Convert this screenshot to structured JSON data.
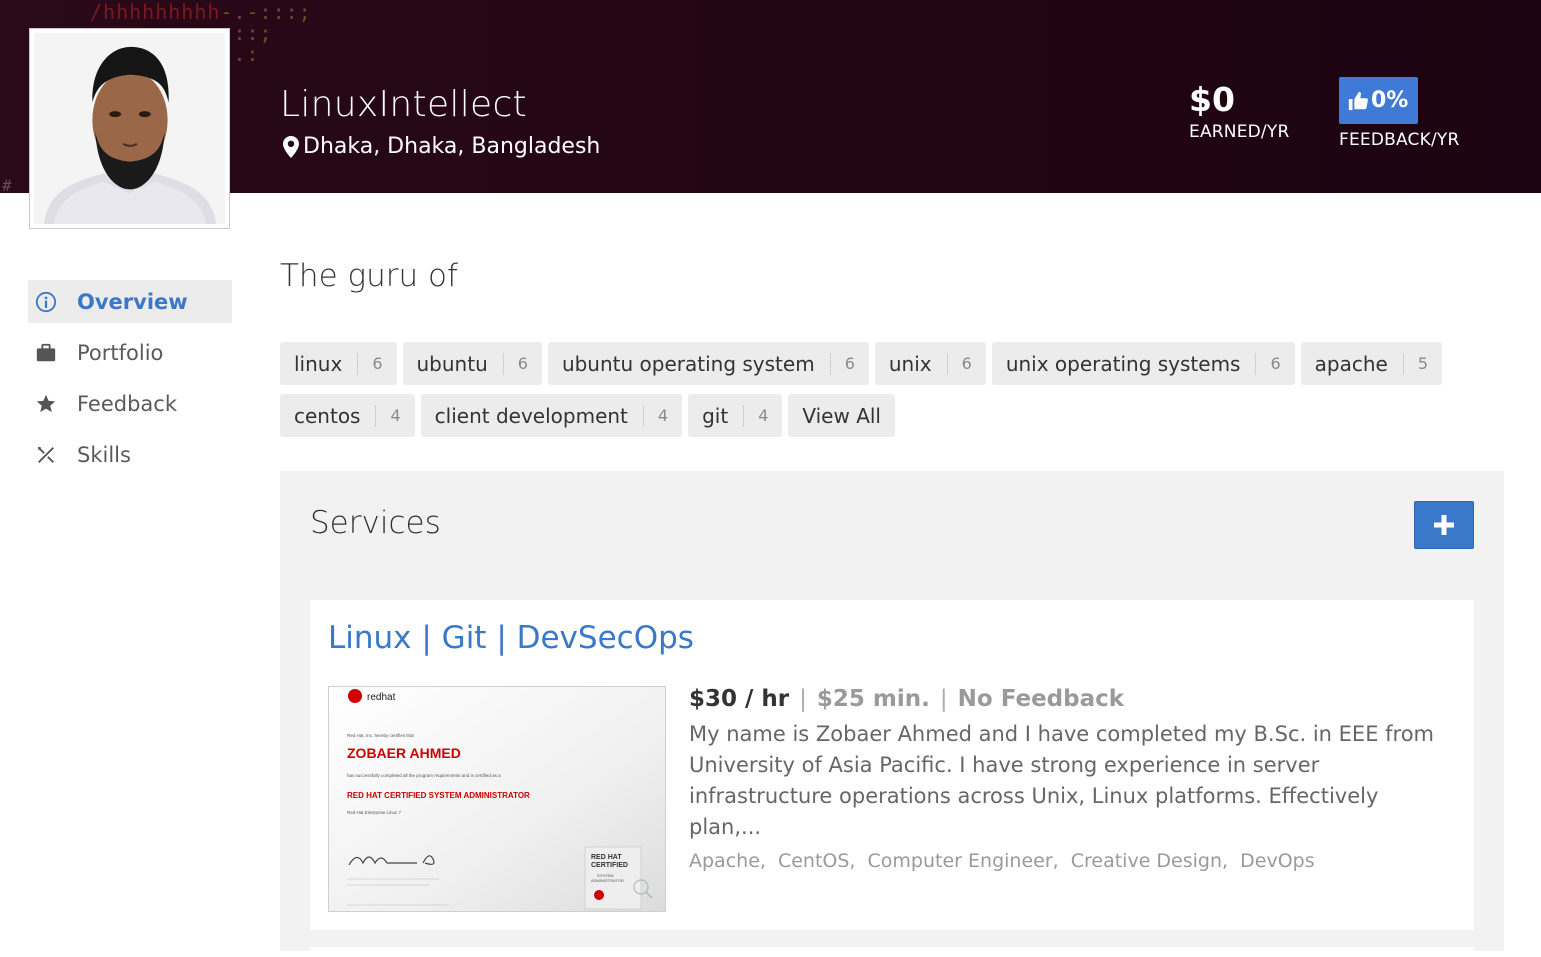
{
  "header": {
    "name": "LinuxIntellect",
    "location": "Dhaka, Dhaka, Bangladesh",
    "earned": {
      "value": "$0",
      "label": "EARNED/YR"
    },
    "feedback": {
      "value": "0%",
      "label": "FEEDBACK/YR"
    }
  },
  "sidebar": {
    "items": [
      {
        "label": "Overview",
        "icon": "info-circle-icon",
        "active": true
      },
      {
        "label": "Portfolio",
        "icon": "briefcase-icon",
        "active": false
      },
      {
        "label": "Feedback",
        "icon": "star-icon",
        "active": false
      },
      {
        "label": "Skills",
        "icon": "tools-icon",
        "active": false
      }
    ]
  },
  "guru": {
    "title": "The guru of",
    "tags": [
      {
        "label": "linux",
        "count": "6"
      },
      {
        "label": "ubuntu",
        "count": "6"
      },
      {
        "label": "ubuntu operating system",
        "count": "6"
      },
      {
        "label": "unix",
        "count": "6"
      },
      {
        "label": "unix operating systems",
        "count": "6"
      },
      {
        "label": "apache",
        "count": "5"
      },
      {
        "label": "centos",
        "count": "4"
      },
      {
        "label": "client development",
        "count": "4"
      },
      {
        "label": "git",
        "count": "4"
      }
    ],
    "view_all": "View All"
  },
  "services": {
    "title": "Services",
    "card": {
      "name": "Linux | Git | DevSecOps",
      "rate": "$30 / hr",
      "minimum": "$25 min.",
      "feedback": "No Feedback",
      "separator": "|",
      "description": "My name is Zobaer Ahmed and I have completed my B.Sc. in EEE from University of Asia Pacific. I have strong experience in server infrastructure operations across Unix, Linux platforms. Effectively plan,...",
      "skills": [
        "Apache,",
        "CentOS,",
        "Computer Engineer,",
        "Creative Design,",
        "DevOps"
      ],
      "certificate": {
        "brand": "redhat",
        "intro": "Red Hat, Inc. hereby certifies that",
        "holder": "ZOBAER AHMED",
        "completion": "has successfully completed all the program requirements and is certified as a",
        "title": "RED HAT CERTIFIED SYSTEM ADMINISTRATOR",
        "product": "Red Hat Enterprise Linux 7",
        "seal_line1": "RED HAT",
        "seal_line2": "CERTIFIED",
        "seal_line3": "SYSTEM",
        "seal_line4": "ADMINISTRATOR"
      }
    }
  },
  "colors": {
    "header_bg": "#240614",
    "accent": "#3a78c9",
    "badge": "#3f7bd6",
    "cert_red": "#cc0000"
  }
}
